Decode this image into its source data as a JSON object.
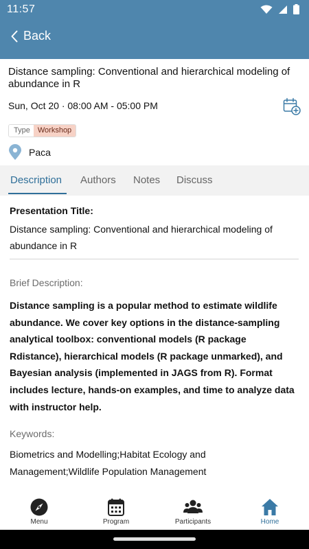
{
  "status_bar": {
    "time": "11:57"
  },
  "app_bar": {
    "back_label": "Back"
  },
  "session": {
    "title": "Distance sampling: Conventional and hierarchical modeling of abundance in R",
    "datetime": "Sun, Oct 20 · 08:00 AM - 05:00 PM",
    "type_key": "Type",
    "type_value": "Workshop",
    "location": "Paca"
  },
  "tabs": [
    {
      "label": "Description",
      "active": true
    },
    {
      "label": "Authors",
      "active": false
    },
    {
      "label": "Notes",
      "active": false
    },
    {
      "label": "Discuss",
      "active": false
    }
  ],
  "description": {
    "presentation_title_heading": "Presentation Title:",
    "presentation_title": "Distance sampling: Conventional and hierarchical modeling of abundance in R",
    "brief_heading": "Brief Description:",
    "brief_text": "Distance sampling is a popular method to estimate wildlife abundance.  We cover key options in the distance-sampling analytical toolbox:  conventional models (R package Rdistance), hierarchical models (R package unmarked), and Bayesian analysis (implemented in JAGS from R).  Format includes lecture, hands-on examples, and time to analyze data with instructor help.",
    "keywords_heading": "Keywords:",
    "keywords_text": "Biometrics and Modelling;Habitat Ecology and Management;Wildlife Population Management"
  },
  "bottom_nav": [
    {
      "label": "Menu",
      "icon": "compass-icon",
      "active": false
    },
    {
      "label": "Program",
      "icon": "calendar-icon",
      "active": false
    },
    {
      "label": "Participants",
      "icon": "people-icon",
      "active": false
    },
    {
      "label": "Home",
      "icon": "home-icon",
      "active": true
    }
  ],
  "colors": {
    "app_bar": "#4f86ad",
    "accent": "#2f6f99",
    "workshop_badge_bg": "#f7d2c6",
    "tab_bar_bg": "#f2f2f2"
  }
}
